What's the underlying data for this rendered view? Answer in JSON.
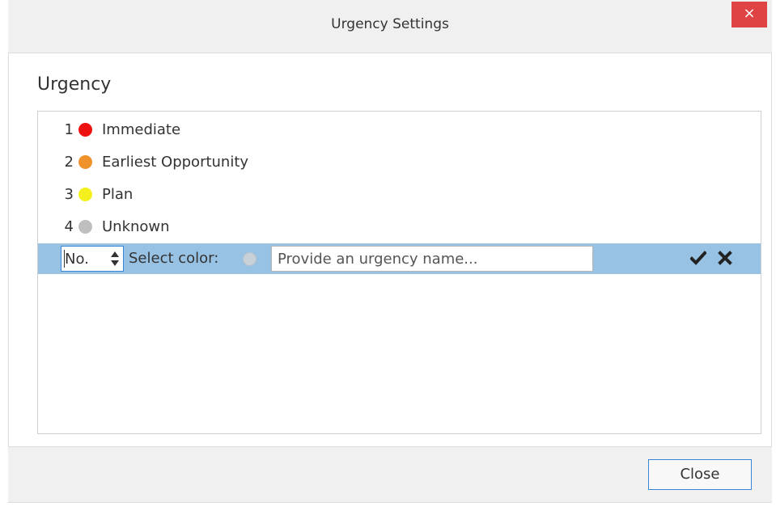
{
  "window": {
    "title": "Urgency Settings",
    "close_glyph": "×",
    "close_color": "#e04343"
  },
  "section": {
    "heading": "Urgency"
  },
  "urgency_list": [
    {
      "number": "1",
      "label": "Immediate",
      "color": "#ee1111"
    },
    {
      "number": "2",
      "label": "Earliest Opportunity",
      "color": "#f0922b"
    },
    {
      "number": "3",
      "label": "Plan",
      "color": "#f5f01d"
    },
    {
      "number": "4",
      "label": "Unknown",
      "color": "#bfbfbf"
    }
  ],
  "new_entry": {
    "number_placeholder": "No.",
    "color_label": "Select color:",
    "name_placeholder": "Provide an urgency name...",
    "confirm_icon": "checkmark-icon",
    "cancel_icon": "close-icon",
    "row_highlight": "#98c2e3"
  },
  "footer": {
    "close_label": "Close"
  }
}
